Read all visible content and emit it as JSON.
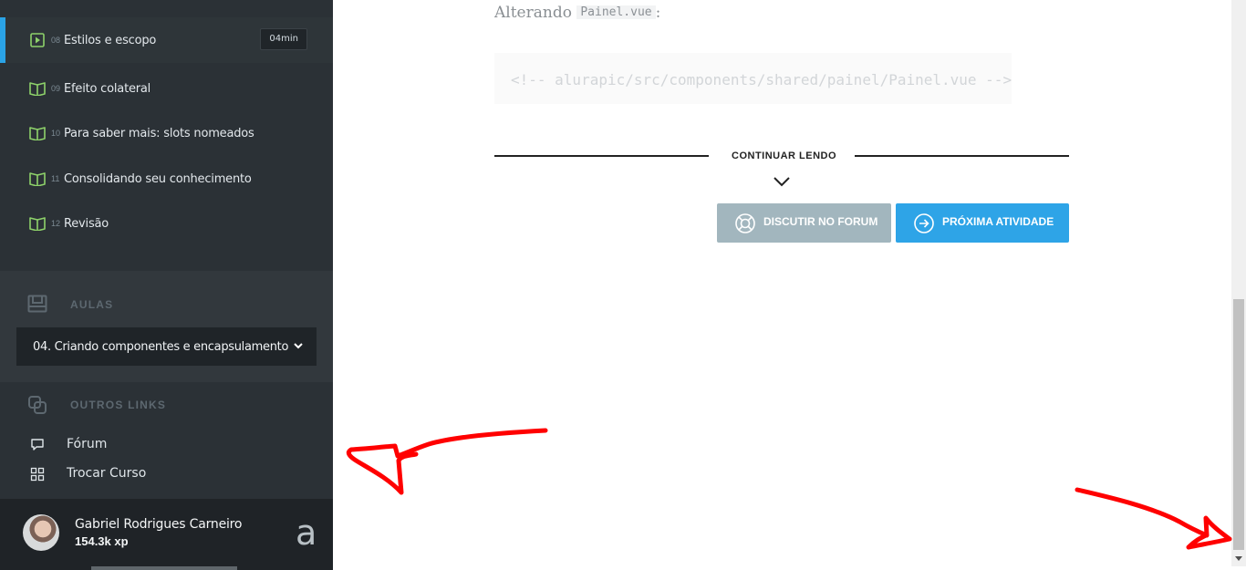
{
  "sidebar": {
    "lessons": [
      {
        "num": "08",
        "title": "Estilos e escopo",
        "badge": "04min",
        "icon": "play-icon",
        "active": true
      },
      {
        "num": "09",
        "title": "Efeito colateral",
        "icon": "book-icon"
      },
      {
        "num": "10",
        "title": "Para saber mais: slots nomeados",
        "icon": "book-icon"
      },
      {
        "num": "11",
        "title": "Consolidando seu conhecimento",
        "icon": "book-icon"
      },
      {
        "num": "12",
        "title": "Revisão",
        "icon": "book-icon"
      }
    ],
    "aulas_label": "AULAS",
    "current_course": "04. Criando componentes e encapsulamento",
    "outros_links_label": "OUTROS LINKS",
    "links": [
      {
        "label": "Fórum",
        "icon": "chat-icon"
      },
      {
        "label": "Trocar Curso",
        "icon": "grid-icon"
      }
    ],
    "user": {
      "name": "Gabriel Rodrigues Carneiro",
      "xp": "154.3k xp"
    },
    "brand": "a"
  },
  "main": {
    "altering_text": "Alterando",
    "altering_file": "Painel.vue",
    "altering_suffix": ":",
    "code_line": "<!-- alurapic/src/components/shared/painel/Painel.vue -->",
    "continue_label": "CONTINUAR LENDO",
    "forum_button": "DISCUTIR NO FORUM",
    "next_button": "PRÓXIMA ATIVIDADE"
  },
  "colors": {
    "accent": "#2ea4e7",
    "lesson_icon": "#8ed26a",
    "forum_button": "#a2b6be",
    "annotation": "#ff0000"
  }
}
